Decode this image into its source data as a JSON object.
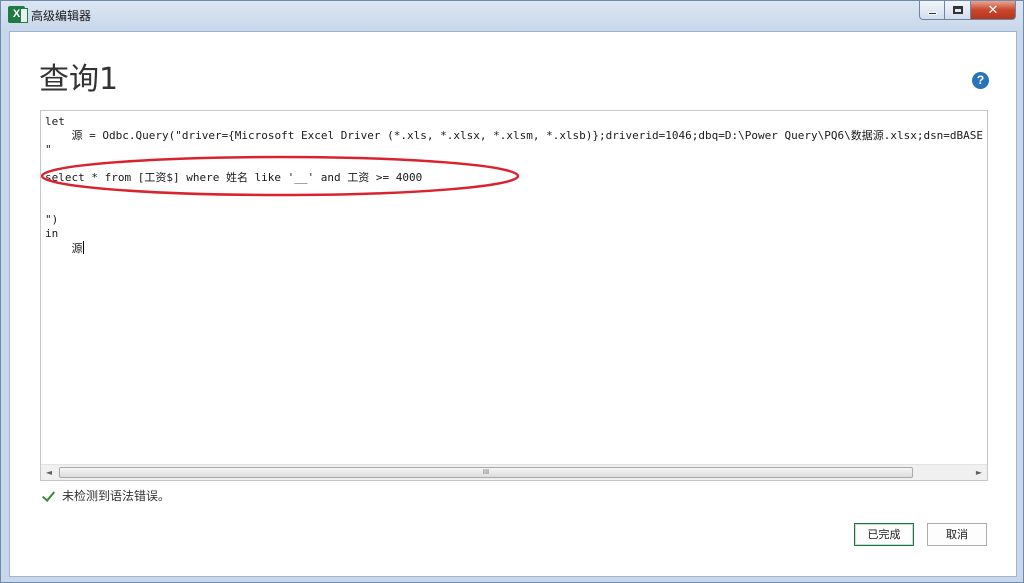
{
  "window": {
    "title": "高级编辑器",
    "app_icon_glyph": "X",
    "icon": "excel-icon",
    "close_glyph": "✕"
  },
  "page": {
    "title": "查询1",
    "help_glyph": "?"
  },
  "editor": {
    "lines": [
      "let",
      "    源 = Odbc.Query(\"driver={Microsoft Excel Driver (*.xls, *.xlsx, *.xlsm, *.xlsb)};driverid=1046;dbq=D:\\Power Query\\PQ6\\数据源.xlsx;dsn=dBASE",
      "\"",
      "",
      "select * from [工资$] where 姓名 like '__' and 工资 >= 4000",
      "",
      "",
      "\")",
      "in",
      "    源"
    ],
    "annotation_color": "#d9232e",
    "scroll_grip": "III",
    "scroll_left_glyph": "◄",
    "scroll_right_glyph": "►"
  },
  "status": {
    "text": "未检测到语法错误。",
    "color": "#3a8a3a"
  },
  "buttons": {
    "done_label": "已完成",
    "cancel_label": "取消",
    "accent": "#217346"
  }
}
